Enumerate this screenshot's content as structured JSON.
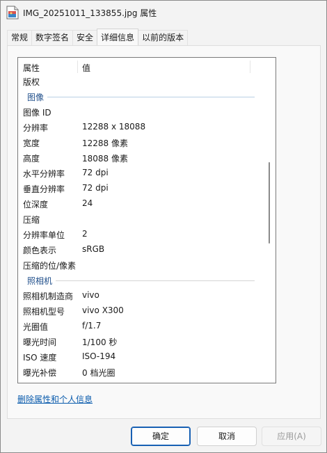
{
  "window": {
    "title": "IMG_20251011_133855.jpg 属性"
  },
  "tabs": [
    {
      "label": "常规"
    },
    {
      "label": "数字签名"
    },
    {
      "label": "安全"
    },
    {
      "label": "详细信息"
    },
    {
      "label": "以前的版本"
    }
  ],
  "details": {
    "header": {
      "property": "属性",
      "value": "值"
    },
    "rows": [
      {
        "k": "版权",
        "v": ""
      },
      {
        "group": "图像"
      },
      {
        "k": "图像 ID",
        "v": ""
      },
      {
        "k": "分辨率",
        "v": "12288 x 18088"
      },
      {
        "k": "宽度",
        "v": "12288 像素"
      },
      {
        "k": "高度",
        "v": "18088 像素"
      },
      {
        "k": "水平分辨率",
        "v": "72 dpi"
      },
      {
        "k": "垂直分辨率",
        "v": "72 dpi"
      },
      {
        "k": "位深度",
        "v": "24"
      },
      {
        "k": "压缩",
        "v": ""
      },
      {
        "k": "分辨率单位",
        "v": "2"
      },
      {
        "k": "颜色表示",
        "v": "sRGB"
      },
      {
        "k": "压缩的位/像素",
        "v": ""
      },
      {
        "group": "照相机"
      },
      {
        "k": "照相机制造商",
        "v": "vivo"
      },
      {
        "k": "照相机型号",
        "v": "vivo X300"
      },
      {
        "k": "光圈值",
        "v": "f/1.7"
      },
      {
        "k": "曝光时间",
        "v": "1/100 秒"
      },
      {
        "k": "ISO 速度",
        "v": "ISO-194"
      },
      {
        "k": "曝光补偿",
        "v": "0 档光圈"
      }
    ]
  },
  "remove_link": "删除属性和个人信息",
  "buttons": {
    "ok": "确定",
    "cancel": "取消",
    "apply": "应用(A)"
  }
}
